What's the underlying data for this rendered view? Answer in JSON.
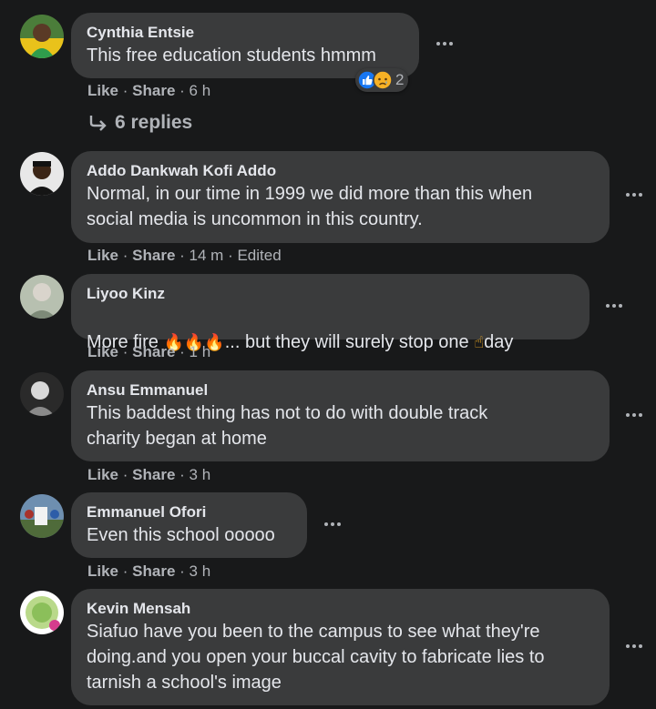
{
  "colors": {
    "background": "#18191a",
    "bubble": "#3a3b3c",
    "primary_text": "#e4e6eb",
    "secondary_text": "#b0b3b8",
    "like_blue": "#1877f2"
  },
  "comments": [
    {
      "author": "Cynthia Entsie",
      "text": "This free education students hmmm",
      "actions": {
        "like": "Like",
        "share": "Share",
        "time": "6 h",
        "edited": ""
      },
      "reactions": {
        "icons": [
          "like-icon",
          "sad-icon"
        ],
        "count": "2"
      },
      "replies": "6 replies"
    },
    {
      "author": "Addo Dankwah Kofi Addo",
      "text": "Normal, in our time in 1999 we did more than this when\nsocial media is uncommon in this country.",
      "actions": {
        "like": "Like",
        "share": "Share",
        "time": "14 m",
        "edited": "Edited"
      }
    },
    {
      "author": "Liyoo Kinz",
      "text_before": "More fire ",
      "emoji_fire": "🔥🔥🔥",
      "text_middle": "... but they will surely stop one ",
      "emoji_finger": "☝",
      "text_after": "day",
      "actions": {
        "like": "Like",
        "share": "Share",
        "time": "1 h",
        "edited": ""
      }
    },
    {
      "author": "Ansu Emmanuel",
      "text": "This baddest thing has not to do with double track\ncharity began at home",
      "actions": {
        "like": "Like",
        "share": "Share",
        "time": "3 h",
        "edited": ""
      }
    },
    {
      "author": "Emmanuel Ofori",
      "text": "Even this school ooooo",
      "actions": {
        "like": "Like",
        "share": "Share",
        "time": "3 h",
        "edited": ""
      }
    },
    {
      "author": "Kevin Mensah",
      "text": "Siafuo have you been to the campus to see what they're\ndoing.and you open your buccal cavity to fabricate lies to\ntarnish a school's image"
    }
  ],
  "separators": {
    "dot": "·"
  }
}
